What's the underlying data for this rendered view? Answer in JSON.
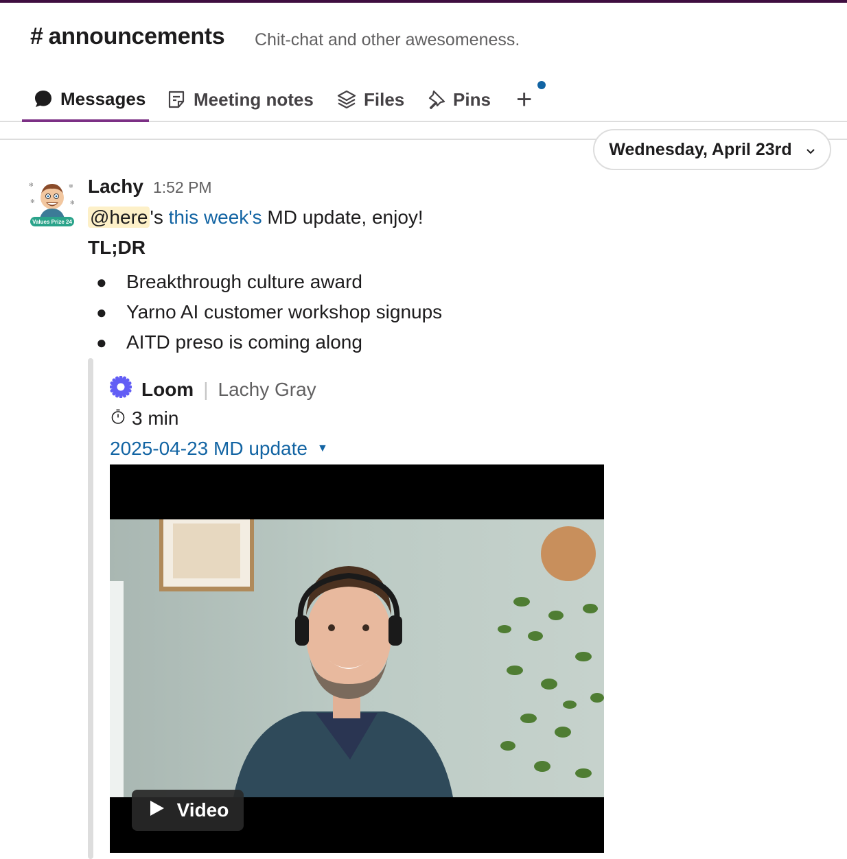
{
  "channel": {
    "hash": "#",
    "name": "announcements",
    "topic": "Chit-chat and other awesomeness."
  },
  "tabs": [
    {
      "label": "Messages",
      "icon": "chat-bubble-icon",
      "active": true
    },
    {
      "label": "Meeting notes",
      "icon": "notes-icon",
      "active": false
    },
    {
      "label": "Files",
      "icon": "layers-icon",
      "active": false
    },
    {
      "label": "Pins",
      "icon": "pin-icon",
      "active": false
    }
  ],
  "add_tab": {
    "label": "+",
    "has_notification": true
  },
  "date_divider": {
    "label": "Wednesday, April 23rd"
  },
  "message": {
    "author": "Lachy",
    "time": "1:52 PM",
    "avatar_badge": "Values Prize 24",
    "mention": "@here",
    "text_part1": "'s ",
    "link_text": "this week's",
    "text_part2": " MD update, enjoy!",
    "tldr": "TL;DR",
    "bullets": [
      "Breakthrough culture award",
      "Yarno AI customer workshop signups",
      "AITD preso is coming along"
    ]
  },
  "attachment": {
    "service": "Loom",
    "author": "Lachy Gray",
    "duration": "3 min",
    "title": "2025-04-23 MD update",
    "video_label": "Video"
  },
  "colors": {
    "accent": "#7c3085",
    "link": "#1264a3",
    "mention_bg": "#fdf0c8",
    "loom": "#625df5"
  }
}
